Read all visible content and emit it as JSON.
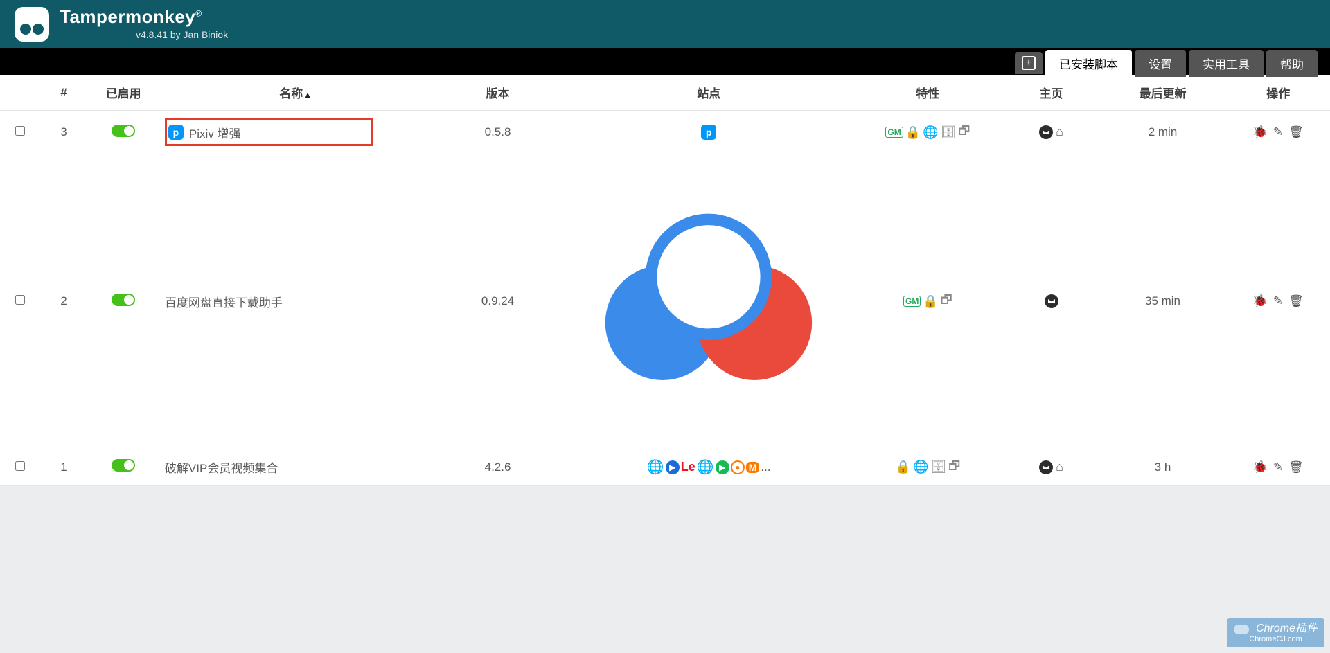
{
  "brand": "Tampermonkey",
  "byline": "v4.8.41 by Jan Biniok",
  "tabs": {
    "new_icon": "plus-box-icon",
    "installed": "已安装脚本",
    "settings": "设置",
    "tools": "实用工具",
    "help": "帮助"
  },
  "columns": {
    "num": "#",
    "enabled": "已启用",
    "name": "名称",
    "version": "版本",
    "site": "站点",
    "features": "特性",
    "home": "主页",
    "updated": "最后更新",
    "ops": "操作"
  },
  "scripts": [
    {
      "num": "3",
      "name": "Pixiv 增强",
      "version": "0.5.8",
      "updated": "2 min",
      "highlight": true,
      "icon": "pixiv",
      "sites": [
        "pixiv"
      ],
      "features": [
        "gm",
        "lock",
        "web",
        "db",
        "win"
      ],
      "home": [
        "wrench",
        "house"
      ]
    },
    {
      "num": "2",
      "name": "百度网盘直接下载助手",
      "version": "0.9.24",
      "updated": "35 min",
      "highlight": false,
      "icon": "baidu",
      "sites": [
        "baidu"
      ],
      "features": [
        "gm",
        "lock",
        "win"
      ],
      "home": [
        "wrench"
      ]
    },
    {
      "num": "1",
      "name": "破解VIP会员视频集合",
      "version": "4.2.6",
      "updated": "3 h",
      "highlight": false,
      "icon": "none",
      "sites": [
        "multi"
      ],
      "features": [
        "lock",
        "web",
        "db",
        "win"
      ],
      "home": [
        "wrench",
        "house"
      ]
    }
  ],
  "watermark": {
    "title": "Chrome插件",
    "sub": "ChromeCJ.com"
  }
}
